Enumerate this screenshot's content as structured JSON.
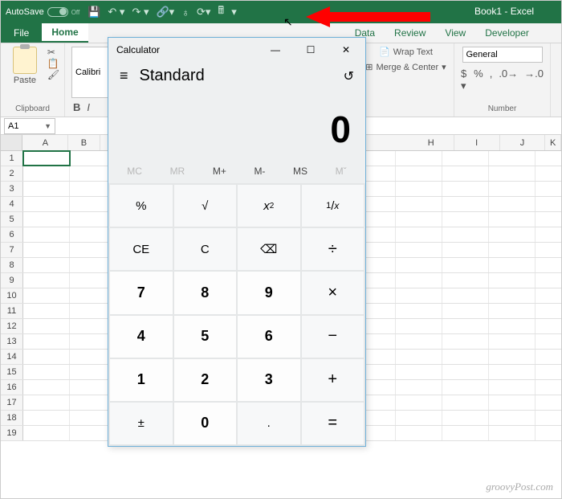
{
  "titlebar": {
    "autosave_label": "AutoSave",
    "autosave_state": "Off",
    "book_label": "Book1  -  Excel"
  },
  "qat_icons": [
    "save",
    "undo",
    "redo",
    "attach",
    "share",
    "refresh",
    "calculator",
    "more"
  ],
  "ribbon_tabs": {
    "file": "File",
    "home": "Home",
    "data": "Data",
    "review": "Review",
    "view": "View",
    "developer": "Developer"
  },
  "ribbon": {
    "clipboard_label": "Clipboard",
    "paste_label": "Paste",
    "font_name": "Calibri",
    "bold": "B",
    "italic": "I",
    "wrap_label": "Wrap Text",
    "merge_label": "Merge & Center",
    "number_format": "General",
    "number_label": "Number"
  },
  "namebox": "A1",
  "columns": [
    "A",
    "B",
    "H",
    "I",
    "J",
    "K"
  ],
  "row_count": 19,
  "calc": {
    "title": "Calculator",
    "mode": "Standard",
    "display": "0",
    "memory": {
      "mc": "MC",
      "mr": "MR",
      "mplus": "M+",
      "mminus": "M-",
      "ms": "MS",
      "mlist": "Mˇ"
    },
    "buttons": {
      "percent": "%",
      "sqrt": "√",
      "sq": "x²",
      "recip": "¹/ₓ",
      "ce": "CE",
      "c": "C",
      "back": "⌫",
      "div": "÷",
      "7": "7",
      "8": "8",
      "9": "9",
      "mul": "×",
      "4": "4",
      "5": "5",
      "6": "6",
      "minus": "−",
      "1": "1",
      "2": "2",
      "3": "3",
      "plus": "+",
      "neg": "±",
      "0": "0",
      "dot": ".",
      "eq": "="
    }
  },
  "watermark": "groovyPost.com"
}
